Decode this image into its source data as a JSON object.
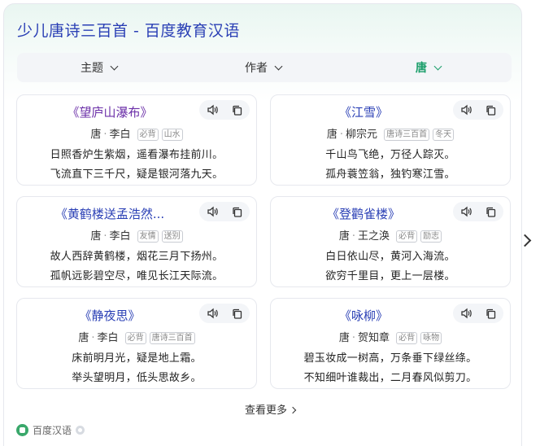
{
  "title": "少儿唐诗三百首 - 百度教育汉语",
  "filters": [
    {
      "label": "主题",
      "active": false
    },
    {
      "label": "作者",
      "active": false
    },
    {
      "label": "唐",
      "active": true
    }
  ],
  "poems": [
    {
      "title": "《望庐山瀑布》",
      "dynasty": "唐",
      "author": "李白",
      "tags": [
        "必背",
        "山水"
      ],
      "lines": [
        "日照香炉生紫烟，遥看瀑布挂前川。",
        "飞流直下三千尺，疑是银河落九天。"
      ]
    },
    {
      "title": "《江雪》",
      "dynasty": "唐",
      "author": "柳宗元",
      "tags": [
        "唐诗三百首",
        "冬天"
      ],
      "lines": [
        "千山鸟飞绝，万径人踪灭。",
        "孤舟蓑笠翁，独钓寒江雪。"
      ]
    },
    {
      "title": "《黄鹤楼送孟浩然...",
      "dynasty": "唐",
      "author": "李白",
      "tags": [
        "友情",
        "送别"
      ],
      "lines": [
        "故人西辞黄鹤楼，烟花三月下扬州。",
        "孤帆远影碧空尽，唯见长江天际流。"
      ]
    },
    {
      "title": "《登鹳雀楼》",
      "dynasty": "唐",
      "author": "王之涣",
      "tags": [
        "必背",
        "励志"
      ],
      "lines": [
        "白日依山尽，黄河入海流。",
        "欲穷千里目，更上一层楼。"
      ]
    },
    {
      "title": "《静夜思》",
      "dynasty": "唐",
      "author": "李白",
      "tags": [
        "必背",
        "唐诗三百首"
      ],
      "lines": [
        "床前明月光，疑是地上霜。",
        "举头望明月，低头思故乡。"
      ]
    },
    {
      "title": "《咏柳》",
      "dynasty": "唐",
      "author": "贺知章",
      "tags": [
        "必背",
        "咏物"
      ],
      "lines": [
        "碧玉妆成一树高，万条垂下绿丝绦。",
        "不知细叶谁裁出，二月春风似剪刀。"
      ]
    }
  ],
  "dot": "·",
  "more_label": "查看更多",
  "source": {
    "label": "百度汉语"
  },
  "icons": {
    "audio": "speaker-icon",
    "copy": "copy-icon",
    "next": "chevron-right-icon"
  },
  "colors": {
    "title": "#2a3fb5",
    "active_filter": "#1a9e6a",
    "visited_title": "#6b2fa8"
  }
}
